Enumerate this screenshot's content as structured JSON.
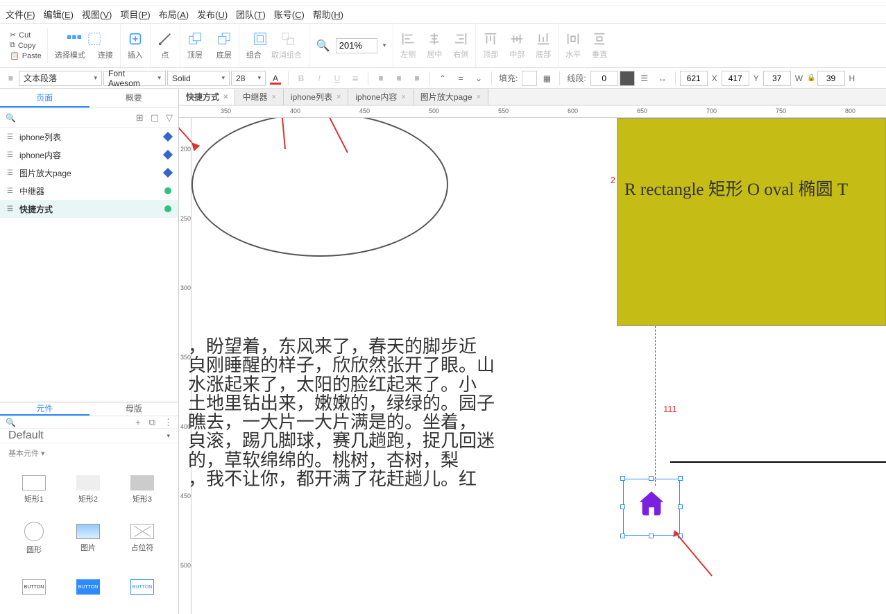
{
  "menu": {
    "file": "文件(",
    "file_k": "F",
    "edit": "编辑(",
    "edit_k": "E",
    "view": "视图(",
    "view_k": "V",
    "project": "项目(",
    "project_k": "P",
    "layout": "布局(",
    "layout_k": "A",
    "publish": "发布(",
    "publish_k": "U",
    "team": "团队(",
    "team_k": "T",
    "account": "账号(",
    "account_k": "C",
    "help": "帮助(",
    "help_k": "H"
  },
  "clipboard": {
    "cut": "Cut",
    "copy": "Copy",
    "paste": "Paste"
  },
  "ribbon": {
    "select_mode": "选择模式",
    "connect": "连接",
    "insert": "插入",
    "point": "点",
    "top_layer": "顶层",
    "bottom_layer": "底层",
    "group": "组合",
    "ungroup": "取消组合",
    "zoom_value": "201%",
    "align_left": "左侧",
    "align_center": "居中",
    "align_right": "右侧",
    "align_top": "顶部",
    "align_mid": "中部",
    "align_bot": "底部",
    "dist_h": "水平",
    "dist_v": "垂直"
  },
  "format": {
    "para_style": "文本段落",
    "font_family": "Font Awesom",
    "font_weight": "Solid",
    "font_size": "28",
    "fill_label": "填充:",
    "line_label": "线段:",
    "line_width": "0",
    "x": "621",
    "x_label": "X",
    "y": "417",
    "y_label": "Y",
    "w": "37",
    "w_label": "W",
    "h": "39",
    "h_label": "H",
    "lock": "🔒"
  },
  "left_tabs": {
    "pages": "页面",
    "outline": "概要"
  },
  "pages": [
    {
      "name": "iphone列表",
      "type": "diamond"
    },
    {
      "name": "iphone内容",
      "type": "diamond"
    },
    {
      "name": "图片放大page",
      "type": "diamond"
    },
    {
      "name": "中继器",
      "type": "ok"
    },
    {
      "name": "快捷方式",
      "type": "ok",
      "active": true
    }
  ],
  "widget_tabs": {
    "widgets": "元件",
    "masters": "母版"
  },
  "widget_lib": "Default",
  "widget_section": "基本元件 ▾",
  "widgets": [
    {
      "label": "矩形1",
      "shape": "rect"
    },
    {
      "label": "矩形2",
      "shape": "rect2"
    },
    {
      "label": "矩形3",
      "shape": "rect3"
    },
    {
      "label": "圆形",
      "shape": "circ"
    },
    {
      "label": "图片",
      "shape": "img"
    },
    {
      "label": "占位符",
      "shape": "ph"
    },
    {
      "label": "",
      "shape": "btn1",
      "txt": "BUTTON"
    },
    {
      "label": "",
      "shape": "btn2",
      "txt": "BUTTON"
    },
    {
      "label": "",
      "shape": "btn3",
      "txt": "BUTTON"
    }
  ],
  "doc_tabs": [
    {
      "label": "快捷方式",
      "active": true
    },
    {
      "label": "中继器"
    },
    {
      "label": "iphone列表"
    },
    {
      "label": "iphone内容"
    },
    {
      "label": "图片放大page"
    }
  ],
  "ruler_h": [
    "350",
    "400",
    "450",
    "500",
    "550",
    "600",
    "650",
    "700",
    "750",
    "800"
  ],
  "ruler_v": [
    "200",
    "250",
    "300",
    "350",
    "400",
    "450",
    "500"
  ],
  "canvas": {
    "yellow_text": "R rectangle 矩形   O oval 椭圆  T",
    "red_small": "2",
    "prose": "，盼望着，东风来了，春天的脚步近\n㒵刚睡醒的样子，欣欣然张开了眼。山\n 水涨起来了，太阳的脸红起来了。小\n土地里钻出来，嫩嫩的，绿绿的。园子\n 瞧去，一大片一大片满是的。坐着，\n㒵滚，踢几脚球，赛几趟跑，捉几回迷\n的，草软绵绵的。桃树，杏树，梨\n，我不让你，都开满了花赶趟儿。红",
    "distance": "111"
  }
}
